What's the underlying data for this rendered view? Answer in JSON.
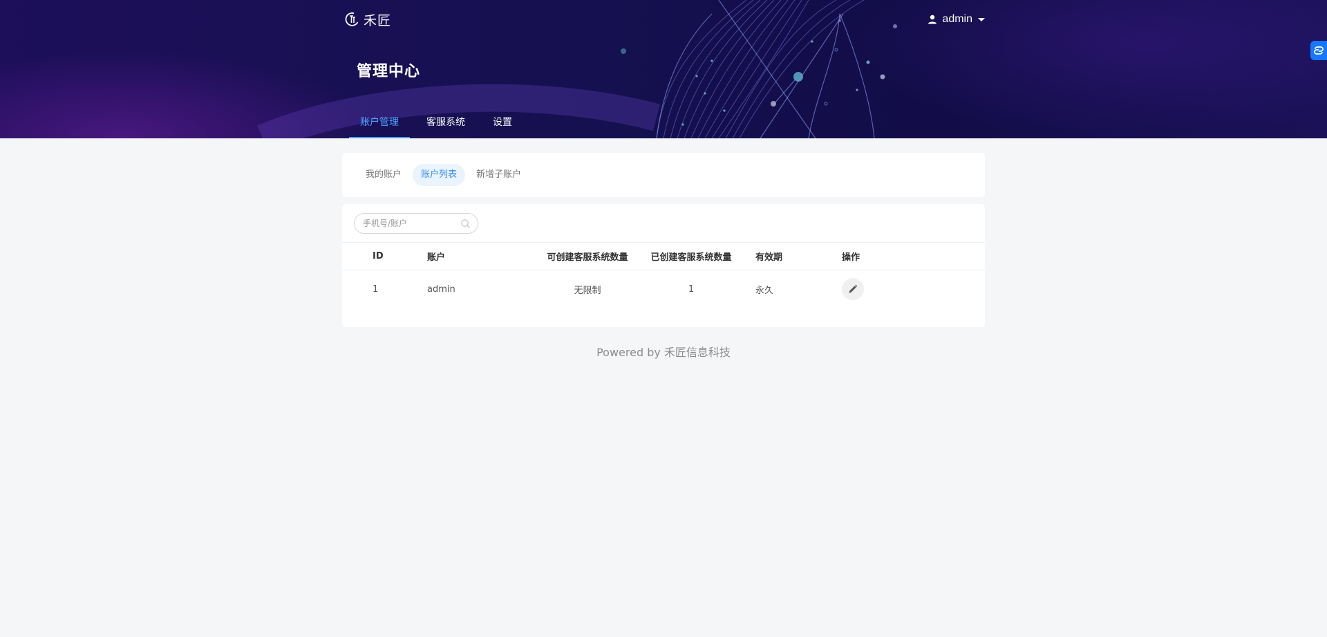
{
  "brand": {
    "name": "禾匠",
    "logo_icon": "logo-mark-icon"
  },
  "user": {
    "name": "admin",
    "icon": "user-icon"
  },
  "page": {
    "title": "管理中心"
  },
  "nav": {
    "tabs": [
      {
        "label": "账户管理",
        "active": true
      },
      {
        "label": "客服系统",
        "active": false
      },
      {
        "label": "设置",
        "active": false
      }
    ]
  },
  "subnav": {
    "tabs": [
      {
        "label": "我的账户",
        "active": false
      },
      {
        "label": "账户列表",
        "active": true
      },
      {
        "label": "新增子账户",
        "active": false
      }
    ]
  },
  "search": {
    "placeholder": "手机号/账户",
    "value": ""
  },
  "table": {
    "columns": [
      "ID",
      "账户",
      "可创建客服系统数量",
      "已创建客服系统数量",
      "有效期",
      "操作"
    ],
    "rows": [
      {
        "id": "1",
        "account": "admin",
        "quota": "无限制",
        "created": "1",
        "expiry": "永久"
      }
    ]
  },
  "footer": {
    "text": "Powered by 禾匠信息科技"
  },
  "colors": {
    "accent": "#4aa3ff",
    "link": "#3b8ff0",
    "header_bg": "#15104f",
    "float_button": "#1677ff"
  }
}
